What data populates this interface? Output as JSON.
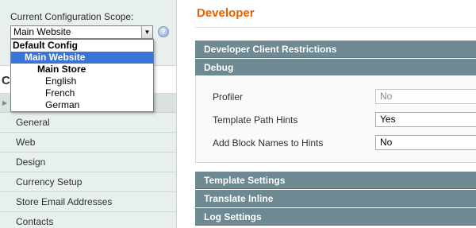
{
  "sidebar": {
    "scope_label": "Current Configuration Scope:",
    "scope_value": "Main Website",
    "arrow_glyph": "▼",
    "help_glyph": "?",
    "header_initial": "C",
    "nav": [
      "General",
      "Web",
      "Design",
      "Currency Setup",
      "Store Email Addresses",
      "Contacts"
    ]
  },
  "scope_dropdown": {
    "options": [
      {
        "label": "Default Config"
      },
      {
        "label": "Main Website"
      },
      {
        "label": "Main Store"
      },
      {
        "label": "English"
      },
      {
        "label": "French"
      },
      {
        "label": "German"
      }
    ]
  },
  "main": {
    "title": "Developer",
    "sections": {
      "client_restrictions": "Developer Client Restrictions",
      "debug": "Debug",
      "template_settings": "Template Settings",
      "translate_inline": "Translate Inline",
      "log_settings": "Log Settings"
    },
    "fields": {
      "profiler": {
        "label": "Profiler",
        "value": "No"
      },
      "template_path_hints": {
        "label": "Template Path Hints",
        "value": "Yes"
      },
      "block_names": {
        "label": "Add Block Names to Hints",
        "value": "No"
      }
    }
  },
  "colors": {
    "title_orange": "#eb5e00",
    "section_bar": "#6f8992",
    "selected_option": "#3875d7",
    "sidebar_bg": "#e7efef"
  }
}
